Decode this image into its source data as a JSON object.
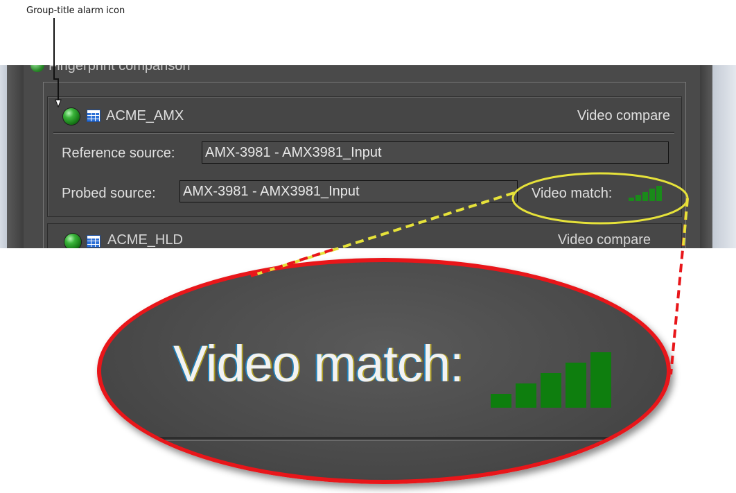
{
  "callout": {
    "label": "Group-title alarm icon"
  },
  "panel": {
    "outer_title": "Fingerprint comparison",
    "group": {
      "name": "ACME_AMX",
      "mode": "Video compare",
      "reference_label": "Reference source:",
      "reference_value": "AMX-3981 - AMX3981_Input",
      "probed_label": "Probed source:",
      "probed_value": "AMX-3981 - AMX3981_Input",
      "match_label": "Video match:",
      "match_level": 5,
      "match_max": 5
    },
    "next_group": {
      "name": "ACME_HLD",
      "mode": "Video compare"
    }
  },
  "zoom": {
    "label": "Video match:",
    "level": 5,
    "max": 5
  },
  "colors": {
    "panel_bg": "#464646",
    "text": "#e0e0e0",
    "alarm_green": "#3ab43a",
    "bars_green": "#1a8a1a",
    "highlight_yellow": "#e6e23a",
    "zoom_border_red": "#e8161a"
  },
  "icons": {
    "alarm": "green-led-icon",
    "group": "grid-table-icon"
  }
}
